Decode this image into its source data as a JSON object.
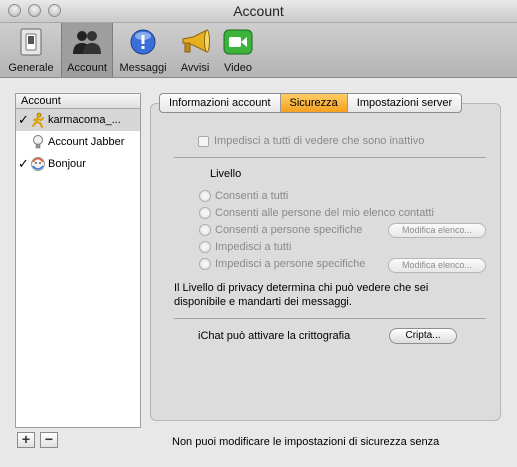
{
  "window": {
    "title": "Account"
  },
  "toolbar": {
    "items": [
      {
        "label": "Generale",
        "icon": "switch-icon"
      },
      {
        "label": "Account",
        "icon": "accounts-icon",
        "selected": true
      },
      {
        "label": "Messaggi",
        "icon": "messages-icon"
      },
      {
        "label": "Avvisi",
        "icon": "megaphone-icon"
      },
      {
        "label": "Video",
        "icon": "video-camera-icon"
      }
    ]
  },
  "sidebar": {
    "header": "Account",
    "accounts": [
      {
        "name": "karmacoma_...",
        "checked": true,
        "selected": true,
        "icon": "aim-runner-icon"
      },
      {
        "name": "Account Jabber",
        "checked": false,
        "selected": false,
        "icon": "lightbulb-icon"
      },
      {
        "name": "Bonjour",
        "checked": true,
        "selected": false,
        "icon": "bonjour-icon"
      }
    ],
    "check_mark": "✓",
    "add_label": "+",
    "remove_label": "−"
  },
  "tabs": {
    "info": "Informazioni account",
    "security": "Sicurezza",
    "server": "Impostazioni server"
  },
  "security": {
    "hide_idle_label": "Impedisci a tutti di vedere che sono inattivo",
    "level_title": "Livello",
    "options": [
      "Consenti a tutti",
      "Consenti alle persone del mio elenco contatti",
      "Consenti a persone specifiche",
      "Impedisci a tutti",
      "Impedisci a persone specifiche"
    ],
    "edit_list_label": "Modifica elenco...",
    "privacy_text_line1": "Il Livello di privacy determina chi può vedere che sei",
    "privacy_text_line2": "disponibile e mandarti dei messaggi.",
    "encryption_label": "iChat può attivare la crittografia",
    "encrypt_button": "Cripta...",
    "footer_note": "Non puoi modificare le impostazioni di sicurezza senza"
  },
  "colors": {
    "selected_tab": "#f4a11f",
    "toolbar_selected": "#9e9e9e"
  }
}
